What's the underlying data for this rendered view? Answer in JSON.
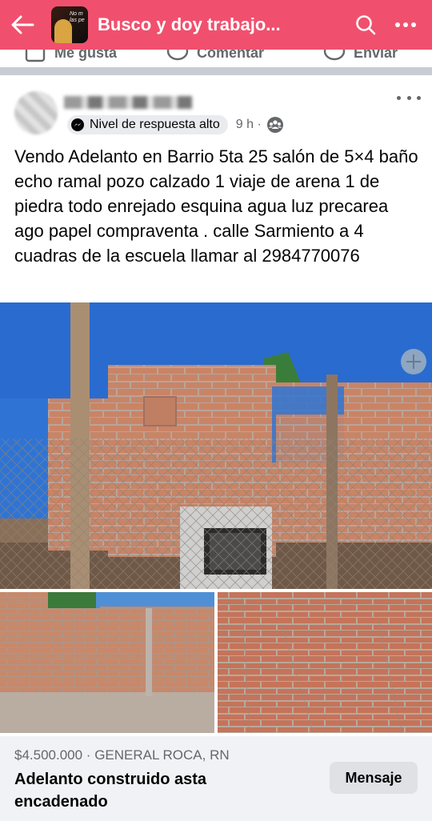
{
  "header": {
    "title": "Busco y doy trabajo...",
    "avatar_caption": "No m las pe",
    "back_icon": "arrow-left-icon",
    "search_icon": "search-icon",
    "more_icon": "more-horizontal-icon",
    "color": "#f0506e"
  },
  "previous_post_actions": {
    "like_label": "Me gusta",
    "comment_label": "Comentar",
    "send_label": "Enviar"
  },
  "post": {
    "author_name": "",
    "badge": "Nivel de respuesta alto",
    "time": "9 h ·",
    "text": "Vendo Adelanto en Barrio 5ta 25 salón de 5×4  baño echo ramal pozo calzado 1 viaje de arena 1 de piedra todo enrejado esquina agua luz precarea ago papel compraventa . calle Sarmiento a 4 cuadras de la escuela llamar al 2984770076",
    "photo_count": 3
  },
  "listing": {
    "price_location": "$4.500.000 · GENERAL ROCA, RN",
    "title": "Adelanto construido asta encadenado",
    "message_button": "Mensaje"
  }
}
